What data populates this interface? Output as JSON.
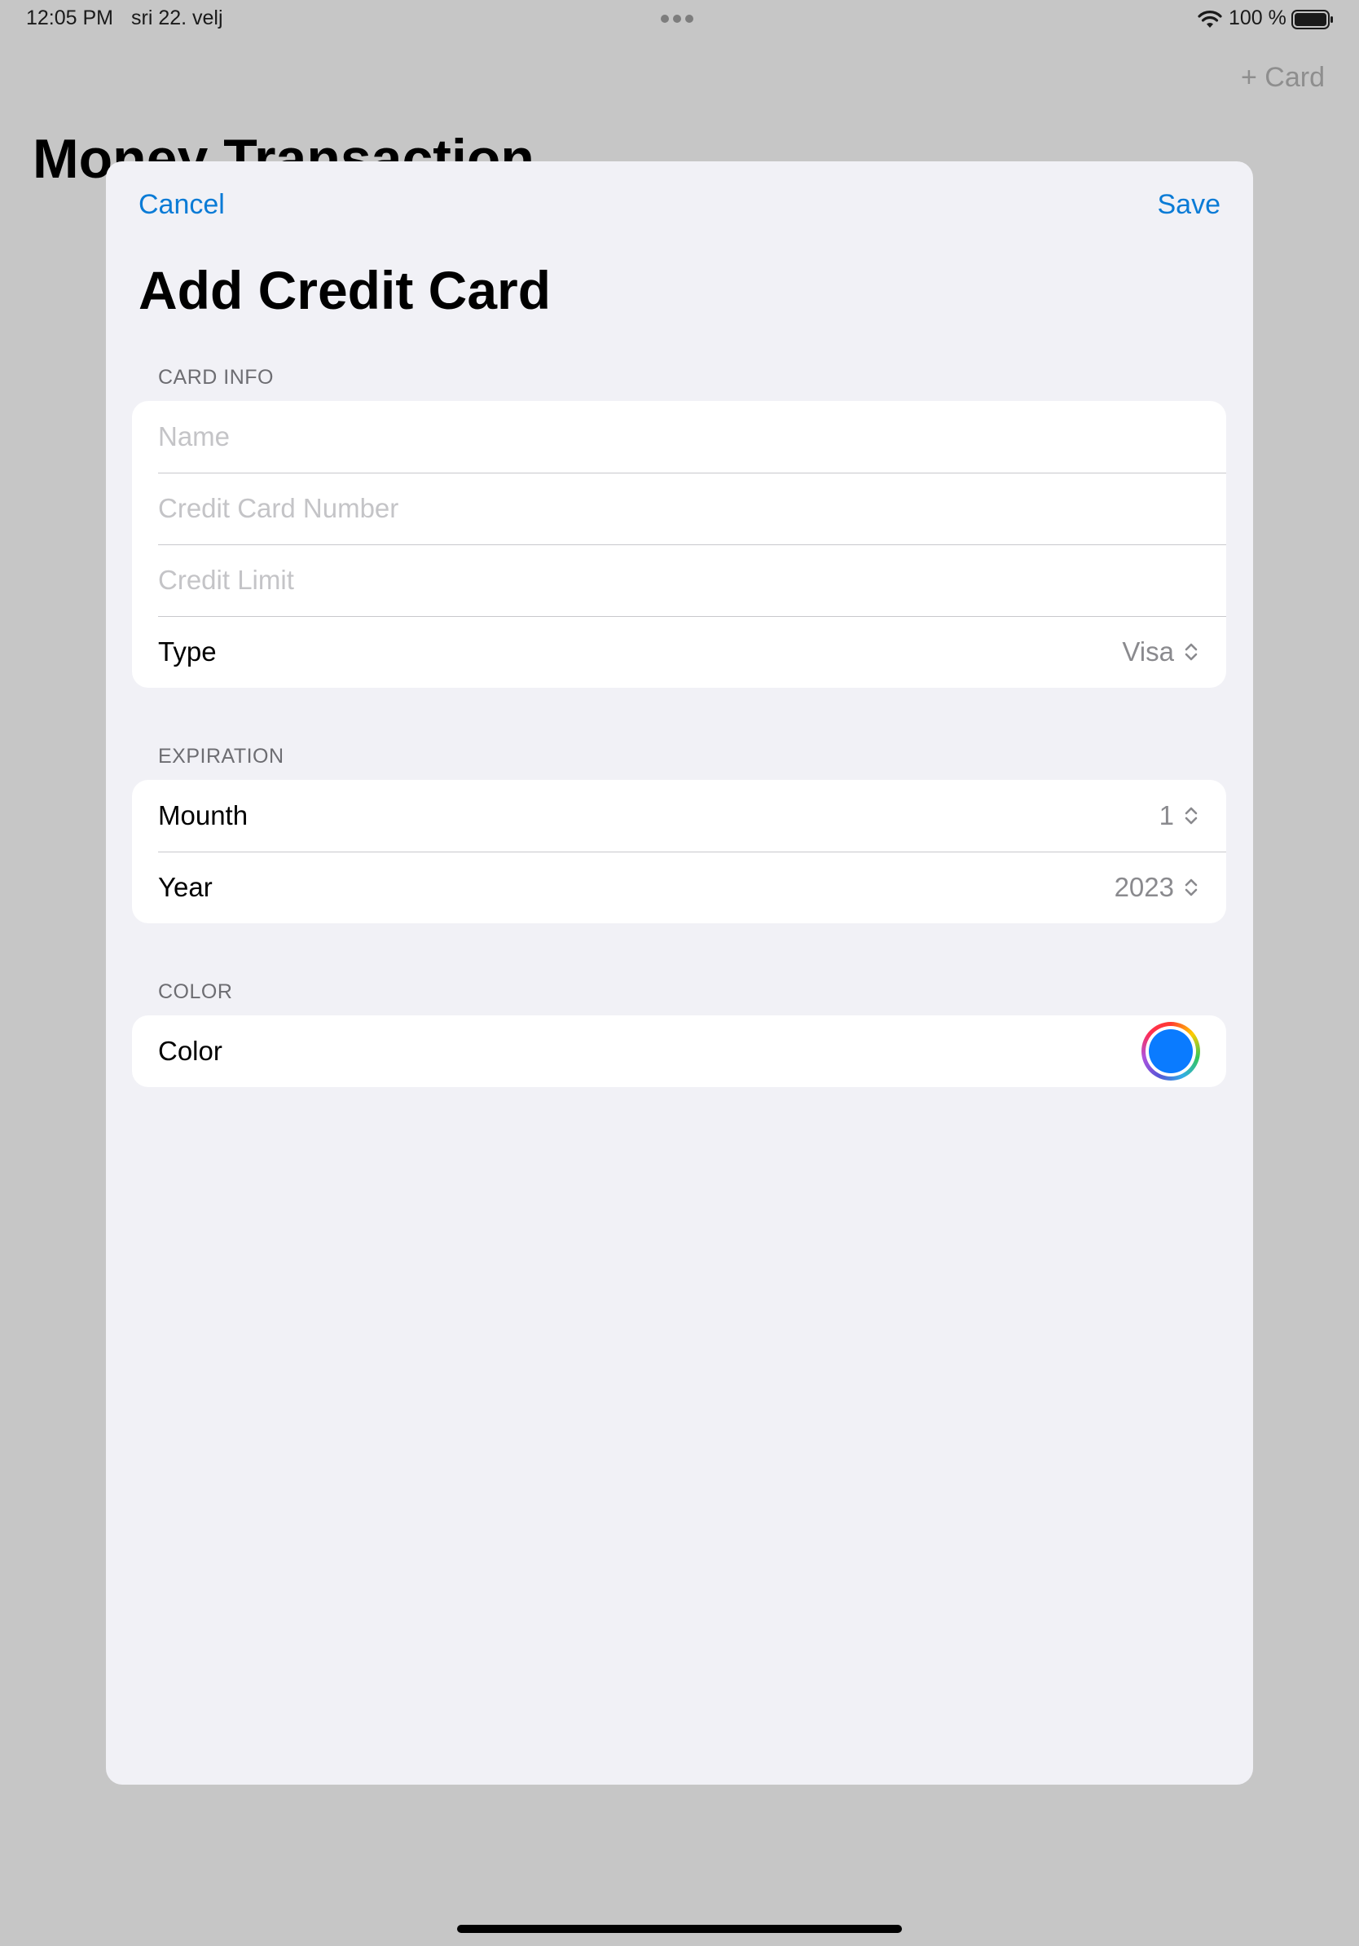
{
  "status_bar": {
    "time": "12:05 PM",
    "date": "sri 22. velj",
    "battery": "100 %"
  },
  "background": {
    "add_card_label": "+ Card",
    "title": "Money Transaction"
  },
  "sheet": {
    "cancel_label": "Cancel",
    "save_label": "Save",
    "title": "Add Credit Card",
    "card_info": {
      "header": "CARD INFO",
      "name_placeholder": "Name",
      "number_placeholder": "Credit Card Number",
      "limit_placeholder": "Credit Limit",
      "type_label": "Type",
      "type_value": "Visa"
    },
    "expiration": {
      "header": "EXPIRATION",
      "month_label": "Mounth",
      "month_value": "1",
      "year_label": "Year",
      "year_value": "2023"
    },
    "color": {
      "header": "COLOR",
      "label": "Color",
      "selected_color": "#0a7bff"
    }
  },
  "icons": {
    "wifi": "wifi-icon",
    "battery": "battery-icon",
    "picker": "chevron-updown-icon",
    "color_well": "color-well-icon"
  },
  "colors": {
    "accent": "#0a7bd6",
    "sheet_bg": "#f1f1f6",
    "dimmed_bg": "#c6c6c6",
    "placeholder": "#c4c4c7",
    "secondary_text": "#8a8a8e"
  }
}
